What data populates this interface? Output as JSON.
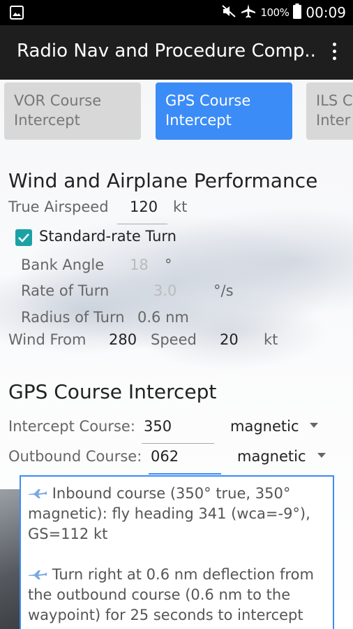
{
  "status_bar": {
    "battery_percent": "100%",
    "time": "00:09"
  },
  "app_bar": {
    "title": "Radio Nav and Procedure Comp..."
  },
  "tabs": [
    {
      "line1": "VOR Course",
      "line2": "Intercept"
    },
    {
      "line1": "GPS Course",
      "line2": "Intercept"
    },
    {
      "line1": "ILS C",
      "line2": "Inter"
    }
  ],
  "wind_section": {
    "title": "Wind and Airplane Performance",
    "true_airspeed_label": "True Airspeed",
    "true_airspeed_value": "120",
    "true_airspeed_unit": "kt",
    "standard_rate_label": "Standard-rate Turn",
    "bank_angle_label": "Bank Angle",
    "bank_angle_value": "18",
    "bank_angle_unit": "°",
    "rate_of_turn_label": "Rate of Turn",
    "rate_of_turn_value": "3.0",
    "rate_of_turn_unit": "°/s",
    "radius_label": "Radius of Turn",
    "radius_value": "0.6 nm",
    "wind_from_label": "Wind From",
    "wind_from_value": "280",
    "speed_label": "Speed",
    "speed_value": "20",
    "speed_unit": "kt"
  },
  "gps_section": {
    "title": "GPS Course Intercept",
    "intercept_label": "Intercept Course:",
    "intercept_value": "350",
    "intercept_ref": "magnetic",
    "outbound_label": "Outbound Course:",
    "outbound_value": "062",
    "outbound_ref": "magnetic"
  },
  "result": {
    "para1": "Inbound course (350° true, 350° magnetic): fly heading 341 (wca=-9°), GS=112 kt",
    "para2": "Turn right at 0.6 nm deflection from the outbound course (0.6 nm to the waypoint) for 25 seconds to intercept"
  },
  "colors": {
    "accent": "#3b8cf7",
    "checkbox": "#1aa2a6",
    "app_bar": "#1e1e1e"
  }
}
